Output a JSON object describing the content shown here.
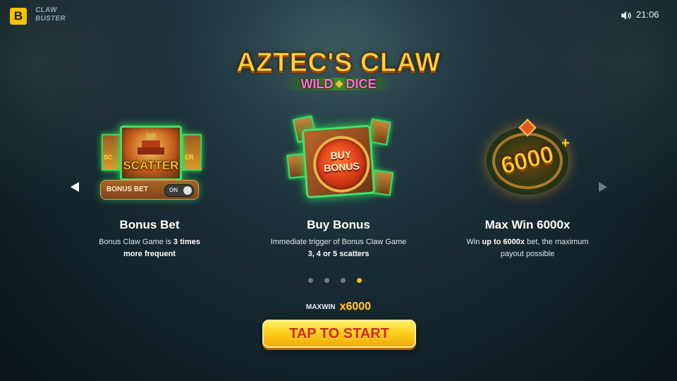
{
  "topbar": {
    "brand_letter": "B",
    "provider_logo": [
      "CLAW",
      "BUSTER"
    ],
    "time": "21:06",
    "sound_icon": "speaker-icon"
  },
  "game": {
    "title": "AZTEC'S CLAW",
    "subtitle_left": "WILD",
    "subtitle_right": "DICE"
  },
  "features": [
    {
      "title": "Bonus Bet",
      "desc_line1_prefix": "Bonus Claw Game is ",
      "desc_line1_bold": "3 times",
      "desc_line2_bold": "more frequent",
      "illustration": {
        "symbol_text": "SCATTER",
        "toggle_label": "BONUS BET",
        "toggle_state": "ON",
        "side_card_text_left": "SC",
        "side_card_text_right": "ER"
      }
    },
    {
      "title": "Buy Bonus",
      "desc_line1": "Immediate trigger of Bonus Claw Game",
      "desc_line2_bold": "3, 4 or 5 scatters",
      "illustration": {
        "coin_line1": "BUY",
        "coin_line2": "BONUS"
      }
    },
    {
      "title": "Max Win 6000x",
      "desc_line1_prefix": "Win ",
      "desc_line1_bold": "up to 6000x",
      "desc_line1_suffix": " bet, the maximum",
      "desc_line2": "payout possible",
      "illustration": {
        "number": "6000",
        "plus": "+"
      }
    }
  ],
  "carousel": {
    "page_count": 4,
    "active_index": 3
  },
  "maxwin": {
    "label": "MAXWIN",
    "value": "x6000"
  },
  "start_button": {
    "label": "TAP TO START"
  },
  "colors": {
    "accent_yellow": "#f2c21a",
    "button_text_red": "#d5260f",
    "glow_green": "#2ee35d"
  }
}
